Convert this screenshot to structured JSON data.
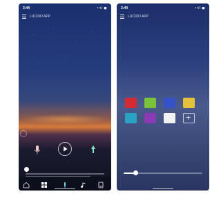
{
  "left_phone": {
    "status": {
      "time": "3:44",
      "signal": "••ıl ◼"
    },
    "app_title": "LUCIDO APP",
    "controls": {
      "mic_label": "",
      "play_label": "",
      "share_label": ""
    },
    "nav_icons": [
      "home-icon",
      "grid-icon",
      "light-icon",
      "music-icon",
      "device-icon"
    ]
  },
  "right_phone": {
    "status": {
      "time": "3:44",
      "signal": "••ıl ◼"
    },
    "app_title": "LUCIDO APP",
    "swatches": [
      {
        "color": "#d42a34"
      },
      {
        "color": "#7ac23a"
      },
      {
        "color": "#3552c8"
      },
      {
        "color": "#e2c33a"
      },
      {
        "color": "#2aa3c2"
      },
      {
        "color": "#8a3ab5"
      },
      {
        "color": "#f2f2f2"
      },
      {
        "color": "transparent"
      }
    ],
    "brightness": 0.15
  },
  "colors": {
    "accent": "#ffffff",
    "sky_top": "#1b2f6e",
    "sunset": "#d87a3a"
  }
}
